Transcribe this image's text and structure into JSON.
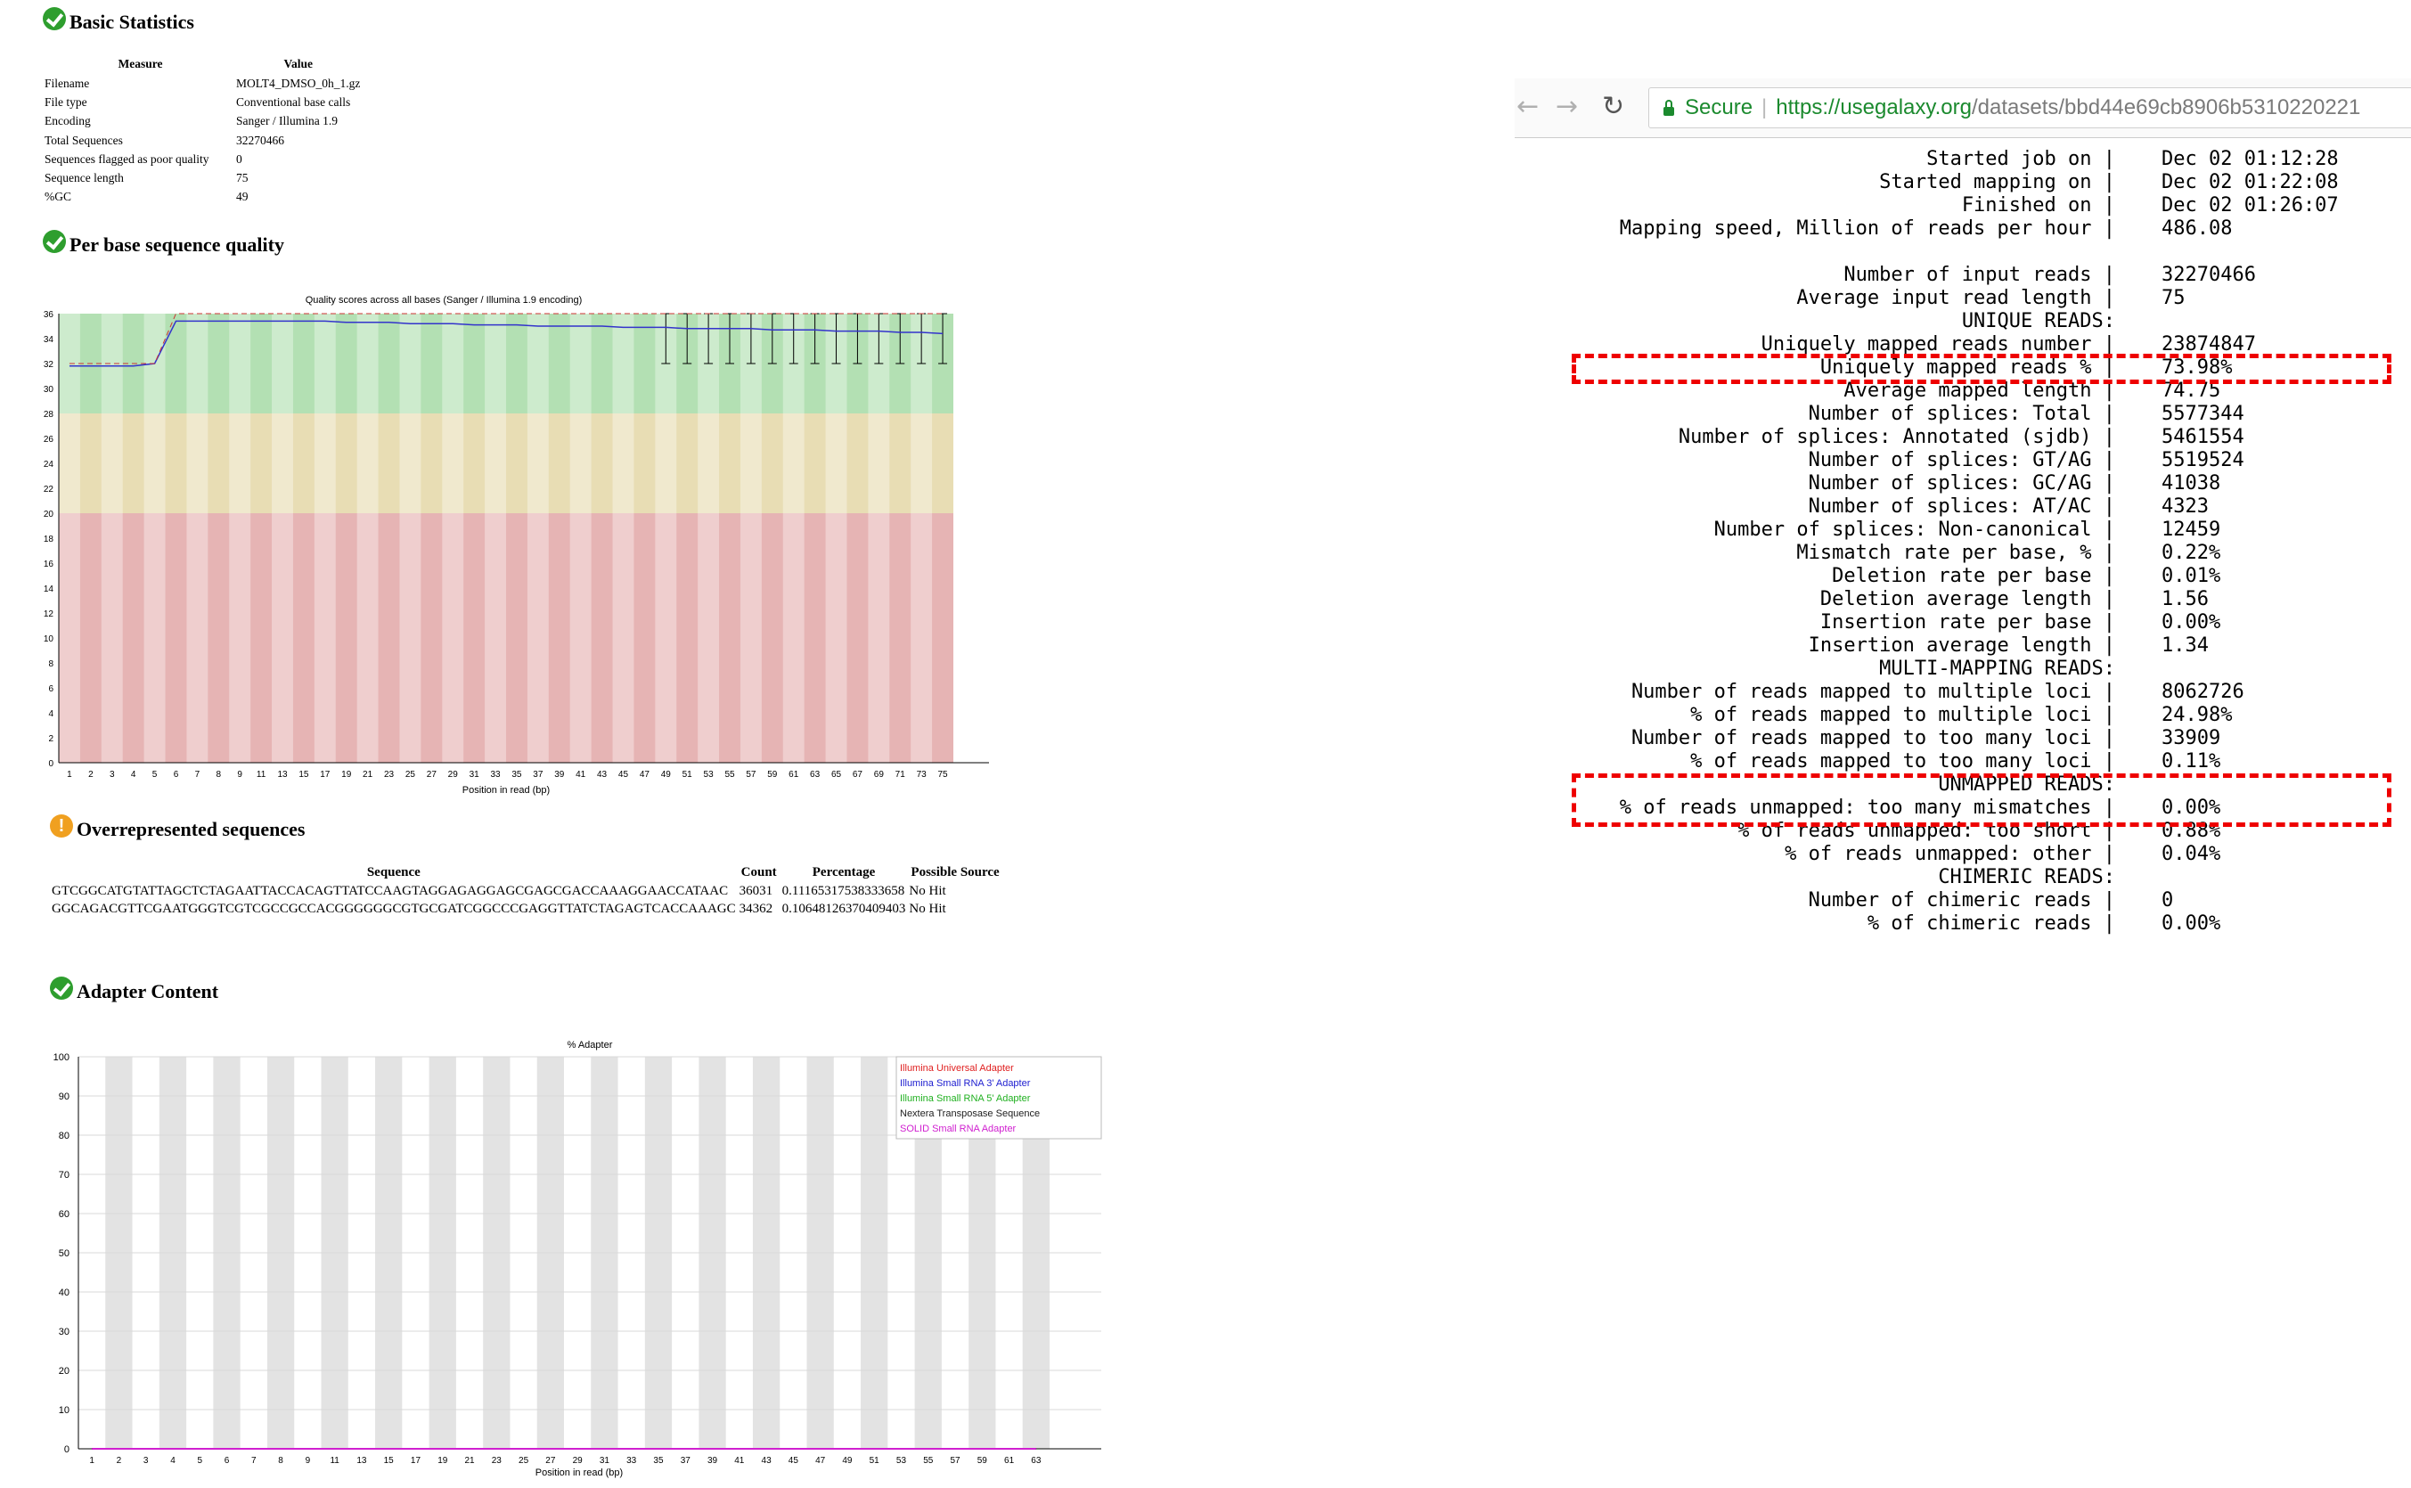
{
  "basic_statistics": {
    "title": "Basic Statistics",
    "headers": [
      "Measure",
      "Value"
    ],
    "rows": [
      [
        "Filename",
        "MOLT4_DMSO_0h_1.gz"
      ],
      [
        "File type",
        "Conventional base calls"
      ],
      [
        "Encoding",
        "Sanger / Illumina 1.9"
      ],
      [
        "Total Sequences",
        "32270466"
      ],
      [
        "Sequences flagged as poor quality",
        "0"
      ],
      [
        "Sequence length",
        "75"
      ],
      [
        "%GC",
        "49"
      ]
    ]
  },
  "per_base_quality": {
    "title": "Per base sequence quality",
    "icon": "check-icon"
  },
  "overrepresented": {
    "title": "Overrepresented sequences",
    "icon": "warning-icon",
    "headers": [
      "Sequence",
      "Count",
      "Percentage",
      "Possible Source"
    ],
    "rows": [
      [
        "GTCGGCATGTATTAGCTCTAGAATTACCACAGTTATCCAAGTAGGAGAGGAGCGAGCGACCAAAGGAACCATAAC",
        "36031",
        "0.11165317538333658",
        "No Hit"
      ],
      [
        "GGCAGACGTTCGAATGGGTCGTCGCCGCCACGGGGGGCGTGCGATCGGCCCGAGGTTATCTAGAGTCACCAAAGC",
        "34362",
        "0.10648126370409403",
        "No Hit"
      ]
    ]
  },
  "adapter_content": {
    "title": "Adapter Content",
    "icon": "check-icon"
  },
  "chart_data": [
    {
      "type": "line",
      "title": "Quality scores across all bases (Sanger / Illumina 1.9 encoding)",
      "xlabel": "Position in read (bp)",
      "ylabel": "",
      "x_ticks": [
        "1",
        "2",
        "3",
        "4",
        "5",
        "6",
        "7",
        "8",
        "9",
        "11",
        "13",
        "15",
        "17",
        "19",
        "21",
        "23",
        "25",
        "27",
        "29",
        "31",
        "33",
        "35",
        "37",
        "39",
        "41",
        "43",
        "45",
        "47",
        "49",
        "51",
        "53",
        "55",
        "57",
        "59",
        "61",
        "63",
        "65",
        "67",
        "69",
        "71",
        "73",
        "75"
      ],
      "y_ticks": [
        0,
        2,
        4,
        6,
        8,
        10,
        12,
        14,
        16,
        18,
        20,
        22,
        24,
        26,
        28,
        30,
        32,
        34,
        36
      ],
      "ylim": [
        0,
        36
      ],
      "bands": [
        {
          "from": 0,
          "to": 20,
          "color": "#e6b4b4"
        },
        {
          "from": 20,
          "to": 28,
          "color": "#e8ddb4"
        },
        {
          "from": 28,
          "to": 36,
          "color": "#b3e0b3"
        }
      ],
      "series": [
        {
          "color": "#3333cc",
          "x": [
            1,
            2,
            3,
            4,
            5,
            6,
            7,
            8,
            9,
            11,
            13,
            15,
            17,
            19,
            21,
            23,
            25,
            27,
            29,
            31,
            33,
            35,
            37,
            39,
            41,
            43,
            45,
            47,
            49,
            51,
            53,
            55,
            57,
            59,
            61,
            63,
            65,
            67,
            69,
            71,
            73,
            75
          ],
          "values": [
            31.8,
            31.8,
            31.8,
            31.8,
            32,
            35.4,
            35.4,
            35.4,
            35.4,
            35.4,
            35.4,
            35.4,
            35.4,
            35.3,
            35.3,
            35.3,
            35.2,
            35.2,
            35.2,
            35.1,
            35.1,
            35.1,
            35.0,
            35.0,
            35.0,
            35.0,
            34.9,
            34.9,
            34.9,
            34.8,
            34.8,
            34.8,
            34.8,
            34.7,
            34.7,
            34.7,
            34.6,
            34.6,
            34.6,
            34.5,
            34.5,
            34.4
          ]
        },
        {
          "color": "#cc3333",
          "x": [
            1,
            2,
            3,
            4,
            5,
            6,
            7,
            8,
            9,
            11,
            13,
            15,
            17,
            19,
            21,
            23,
            25,
            27,
            29,
            31,
            33,
            35,
            37,
            39,
            41,
            43,
            45,
            47,
            49,
            51,
            53,
            55,
            57,
            59,
            61,
            63,
            65,
            67,
            69,
            71,
            73,
            75
          ],
          "values": [
            32,
            32,
            32,
            32,
            32,
            36,
            36,
            36,
            36,
            36,
            36,
            36,
            36,
            36,
            36,
            36,
            36,
            36,
            36,
            36,
            36,
            36,
            36,
            36,
            36,
            36,
            36,
            36,
            36,
            36,
            36,
            36,
            36,
            36,
            36,
            36,
            36,
            36,
            36,
            36,
            36,
            36
          ]
        }
      ],
      "whiskers": {
        "x_from": 49,
        "x_to": 75,
        "low": 32,
        "high": 36
      }
    },
    {
      "type": "line",
      "title": "% Adapter",
      "xlabel": "Position in read (bp)",
      "ylabel": "",
      "x_ticks": [
        "1",
        "2",
        "3",
        "4",
        "5",
        "6",
        "7",
        "8",
        "9",
        "11",
        "13",
        "15",
        "17",
        "19",
        "21",
        "23",
        "25",
        "27",
        "29",
        "31",
        "33",
        "35",
        "37",
        "39",
        "41",
        "43",
        "45",
        "47",
        "49",
        "51",
        "53",
        "55",
        "57",
        "59",
        "61",
        "63"
      ],
      "y_ticks": [
        0,
        10,
        20,
        30,
        40,
        50,
        60,
        70,
        80,
        90,
        100
      ],
      "ylim": [
        0,
        100
      ],
      "legend_position": "top-right",
      "series": [
        {
          "name": "Illumina Universal Adapter",
          "color": "#e02020",
          "values": [
            0,
            0
          ]
        },
        {
          "name": "Illumina Small RNA 3' Adapter",
          "color": "#2020d0",
          "values": [
            0,
            0
          ]
        },
        {
          "name": "Illumina Small RNA 5' Adapter",
          "color": "#20b020",
          "values": [
            0,
            0
          ]
        },
        {
          "name": "Nextera Transposase Sequence",
          "color": "#202020",
          "values": [
            0,
            0
          ]
        },
        {
          "name": "SOLID Small RNA Adapter",
          "color": "#d020d0",
          "values": [
            0,
            0
          ]
        }
      ]
    }
  ],
  "browser": {
    "back_icon": "arrow-left-icon",
    "forward_icon": "arrow-right-icon",
    "reload_icon": "reload-icon",
    "lock_icon": "lock-icon",
    "secure_label": "Secure",
    "url_host": "https://usegalaxy.org",
    "url_path": "/datasets/bbd44e69cb8906b5310220221"
  },
  "star_log": {
    "timing": [
      {
        "label": "Started job on |",
        "value": "Dec 02 01:12:28"
      },
      {
        "label": "Started mapping on |",
        "value": "Dec 02 01:22:08"
      },
      {
        "label": "Finished on |",
        "value": "Dec 02 01:26:07"
      },
      {
        "label": "Mapping speed, Million of reads per hour |",
        "value": "486.08"
      }
    ],
    "input": [
      {
        "label": "Number of input reads |",
        "value": "32270466"
      },
      {
        "label": "Average input read length |",
        "value": "75"
      }
    ],
    "unique_header": "UNIQUE READS:",
    "unique": [
      {
        "label": "Uniquely mapped reads number |",
        "value": "23874847"
      },
      {
        "label": "Uniquely mapped reads % |",
        "value": "73.98%"
      },
      {
        "label": "Average mapped length |",
        "value": "74.75"
      },
      {
        "label": "Number of splices: Total |",
        "value": "5577344"
      },
      {
        "label": "Number of splices: Annotated (sjdb) |",
        "value": "5461554"
      },
      {
        "label": "Number of splices: GT/AG |",
        "value": "5519524"
      },
      {
        "label": "Number of splices: GC/AG |",
        "value": "41038"
      },
      {
        "label": "Number of splices: AT/AC |",
        "value": "4323"
      },
      {
        "label": "Number of splices: Non-canonical |",
        "value": "12459"
      },
      {
        "label": "Mismatch rate per base, % |",
        "value": "0.22%"
      },
      {
        "label": "Deletion rate per base |",
        "value": "0.01%"
      },
      {
        "label": "Deletion average length |",
        "value": "1.56"
      },
      {
        "label": "Insertion rate per base |",
        "value": "0.00%"
      },
      {
        "label": "Insertion average length |",
        "value": "1.34"
      }
    ],
    "multi_header": "MULTI-MAPPING READS:",
    "multi": [
      {
        "label": "Number of reads mapped to multiple loci |",
        "value": "8062726"
      },
      {
        "label": "% of reads mapped to multiple loci |",
        "value": "24.98%"
      },
      {
        "label": "Number of reads mapped to too many loci |",
        "value": "33909"
      },
      {
        "label": "% of reads mapped to too many loci |",
        "value": "0.11%"
      }
    ],
    "unmapped_header": "UNMAPPED READS:",
    "unmapped": [
      {
        "label": "% of reads unmapped: too many mismatches |",
        "value": "0.00%"
      },
      {
        "label": "% of reads unmapped: too short |",
        "value": "0.88%"
      },
      {
        "label": "% of reads unmapped: other |",
        "value": "0.04%"
      }
    ],
    "chimeric_header": "CHIMERIC READS:",
    "chimeric": [
      {
        "label": "Number of chimeric reads |",
        "value": "0"
      },
      {
        "label": "% of chimeric reads |",
        "value": "0.00%"
      }
    ]
  }
}
